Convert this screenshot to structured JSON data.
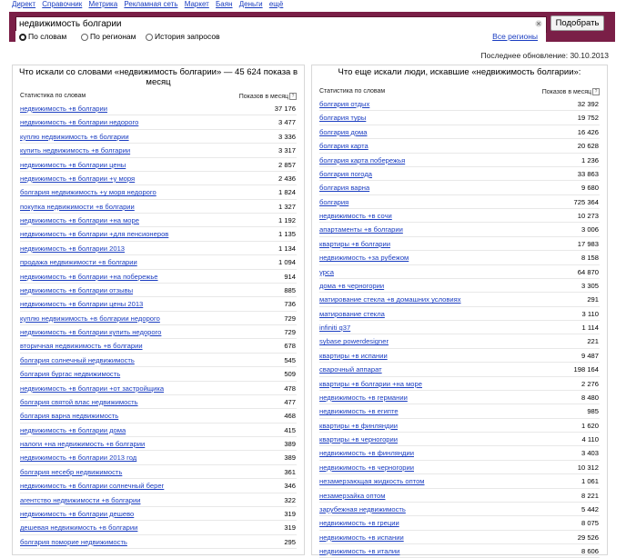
{
  "topnav": [
    "Директ",
    "Справочник",
    "Метрика",
    "Рекламная сеть",
    "Маркет",
    "Баян",
    "Деньги",
    "ещё"
  ],
  "search": {
    "value": "недвижимость болгарии",
    "button": "Подобрать",
    "radios": [
      {
        "label": "По словам",
        "selected": true
      },
      {
        "label": "По регионам",
        "selected": false
      },
      {
        "label": "История запросов",
        "selected": false
      }
    ],
    "all_regions": "Все регионы"
  },
  "updated": "Последнее обновление: 30.10.2013",
  "left": {
    "title": "Что искали со словами «недвижимость болгарии» — 45 624 показа в месяц",
    "col1": "Статистика по словам",
    "col2": "Показов в месяц",
    "rows": [
      {
        "q": "недвижимость +в болгарии",
        "n": "37 176"
      },
      {
        "q": "недвижимость +в болгарии недорого",
        "n": "3 477"
      },
      {
        "q": "куплю недвижимость +в болгарии",
        "n": "3 336"
      },
      {
        "q": "купить недвижимость +в болгарии",
        "n": "3 317"
      },
      {
        "q": "недвижимость +в болгарии цены",
        "n": "2 857"
      },
      {
        "q": "недвижимость +в болгарии +у моря",
        "n": "2 436"
      },
      {
        "q": "болгария недвижимость +у моря недорого",
        "n": "1 824"
      },
      {
        "q": "покупка недвижимости +в болгарии",
        "n": "1 327"
      },
      {
        "q": "недвижимость +в болгарии +на море",
        "n": "1 192"
      },
      {
        "q": "недвижимость +в болгарии +для пенсионеров",
        "n": "1 135"
      },
      {
        "q": "недвижимость +в болгарии 2013",
        "n": "1 134"
      },
      {
        "q": "продажа недвижимости +в болгарии",
        "n": "1 094"
      },
      {
        "q": "недвижимость +в болгарии +на побережье",
        "n": "914"
      },
      {
        "q": "недвижимость +в болгарии отзывы",
        "n": "885"
      },
      {
        "q": "недвижимость +в болгарии цены 2013",
        "n": "736"
      },
      {
        "q": "куплю недвижимость +в болгарии недорого",
        "n": "729"
      },
      {
        "q": "недвижимость +в болгарии купить недорого",
        "n": "729"
      },
      {
        "q": "вторичная недвижимость +в болгарии",
        "n": "678"
      },
      {
        "q": "болгария солнечный недвижимость",
        "n": "545"
      },
      {
        "q": "болгария бургас недвижимость",
        "n": "509"
      },
      {
        "q": "недвижимость +в болгарии +от застройщика",
        "n": "478"
      },
      {
        "q": "болгария святой влас недвижимость",
        "n": "477"
      },
      {
        "q": "болгария варна недвижимость",
        "n": "468"
      },
      {
        "q": "недвижимость +в болгарии дома",
        "n": "415"
      },
      {
        "q": "налоги +на недвижимость +в болгарии",
        "n": "389"
      },
      {
        "q": "недвижимость +в болгарии 2013 год",
        "n": "389"
      },
      {
        "q": "болгария несебр недвижимость",
        "n": "361"
      },
      {
        "q": "недвижимость +в болгарии солнечный берег",
        "n": "346"
      },
      {
        "q": "агентство недвижимости +в болгарии",
        "n": "322"
      },
      {
        "q": "недвижимость +в болгарии дешево",
        "n": "319"
      },
      {
        "q": "дешевая недвижимость +в болгарии",
        "n": "319"
      },
      {
        "q": "болгария поморие недвижимость",
        "n": "295"
      }
    ]
  },
  "right": {
    "title": "Что еще искали люди, искавшие «недвижимость болгарии»:",
    "col1": "Статистика по словам",
    "col2": "Показов в месяц",
    "rows": [
      {
        "q": "болгария отдых",
        "n": "32 392"
      },
      {
        "q": "болгария туры",
        "n": "19 752"
      },
      {
        "q": "болгария дома",
        "n": "16 426"
      },
      {
        "q": "болгария карта",
        "n": "20 628"
      },
      {
        "q": "болгария карта побережья",
        "n": "1 236"
      },
      {
        "q": "болгария погода",
        "n": "33 863"
      },
      {
        "q": "болгария варна",
        "n": "9 680"
      },
      {
        "q": "болгария",
        "n": "725 364"
      },
      {
        "q": "недвижимость +в сочи",
        "n": "10 273"
      },
      {
        "q": "апартаменты +в болгарии",
        "n": "3 006"
      },
      {
        "q": "квартиры +в болгарии",
        "n": "17 983"
      },
      {
        "q": "недвижимость +за рубежом",
        "n": "8 158"
      },
      {
        "q": "урса",
        "n": "64 870"
      },
      {
        "q": "дома +в черногории",
        "n": "3 305"
      },
      {
        "q": "матирование стекла +в домашних условиях",
        "n": "291"
      },
      {
        "q": "матирование стекла",
        "n": "3 110"
      },
      {
        "q": "infiniti q37",
        "n": "1 114"
      },
      {
        "q": "sybase powerdesigner",
        "n": "221"
      },
      {
        "q": "квартиры +в испании",
        "n": "9 487"
      },
      {
        "q": "сварочный аппарат",
        "n": "198 164"
      },
      {
        "q": "квартиры +в болгарии +на море",
        "n": "2 276"
      },
      {
        "q": "недвижимость +в германии",
        "n": "8 480"
      },
      {
        "q": "недвижимость +в египте",
        "n": "985"
      },
      {
        "q": "квартиры +в финляндии",
        "n": "1 620"
      },
      {
        "q": "квартиры +в черногории",
        "n": "4 110"
      },
      {
        "q": "недвижимость +в финляндии",
        "n": "3 403"
      },
      {
        "q": "недвижимость +в черногории",
        "n": "10 312"
      },
      {
        "q": "незамерзающая жидкость оптом",
        "n": "1 061"
      },
      {
        "q": "незамерзайка оптом",
        "n": "8 221"
      },
      {
        "q": "зарубежная недвижимость",
        "n": "5 442"
      },
      {
        "q": "недвижимость +в греции",
        "n": "8 075"
      },
      {
        "q": "недвижимость +в испании",
        "n": "29 526"
      },
      {
        "q": "недвижимость +в италии",
        "n": "8 606"
      }
    ]
  }
}
